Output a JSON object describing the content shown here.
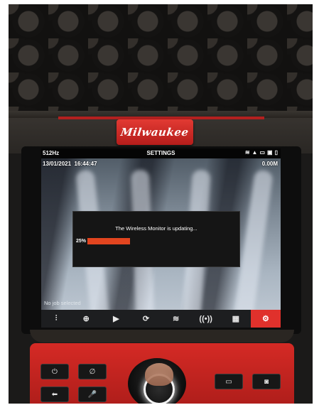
{
  "device": {
    "brand": "Milwaukee"
  },
  "status_bar": {
    "frequency": "512Hz",
    "title": "SETTINGS",
    "icons": [
      "wifi-icon",
      "warning-icon",
      "sd-card-icon",
      "usb-icon",
      "battery-icon"
    ]
  },
  "overlay": {
    "date": "13/01/2021",
    "time": "16:44:47",
    "distance": "0.00M",
    "job": "No job selected"
  },
  "dialog": {
    "message": "The Wireless Monitor is updating...",
    "progress_label": "25%",
    "progress": 0.25,
    "progress_color": "#e2451f"
  },
  "toolbar": {
    "items": [
      {
        "name": "sonde-icon",
        "glyph": "⫶"
      },
      {
        "name": "zoom-icon",
        "glyph": "⊕"
      },
      {
        "name": "tag-icon",
        "glyph": "▶"
      },
      {
        "name": "rotate-icon",
        "glyph": "⟳"
      },
      {
        "name": "locator-icon",
        "glyph": "≋"
      },
      {
        "name": "wireless-icon",
        "glyph": "((•))"
      },
      {
        "name": "grid-icon",
        "glyph": "▦"
      },
      {
        "name": "settings-icon",
        "glyph": "⚙"
      }
    ],
    "active_color": "#e0312c"
  },
  "hardware_buttons": {
    "power": "⏻",
    "mute": "∅",
    "back": "⬅",
    "mic": "🎤",
    "video": "▭",
    "photo": "◙"
  }
}
